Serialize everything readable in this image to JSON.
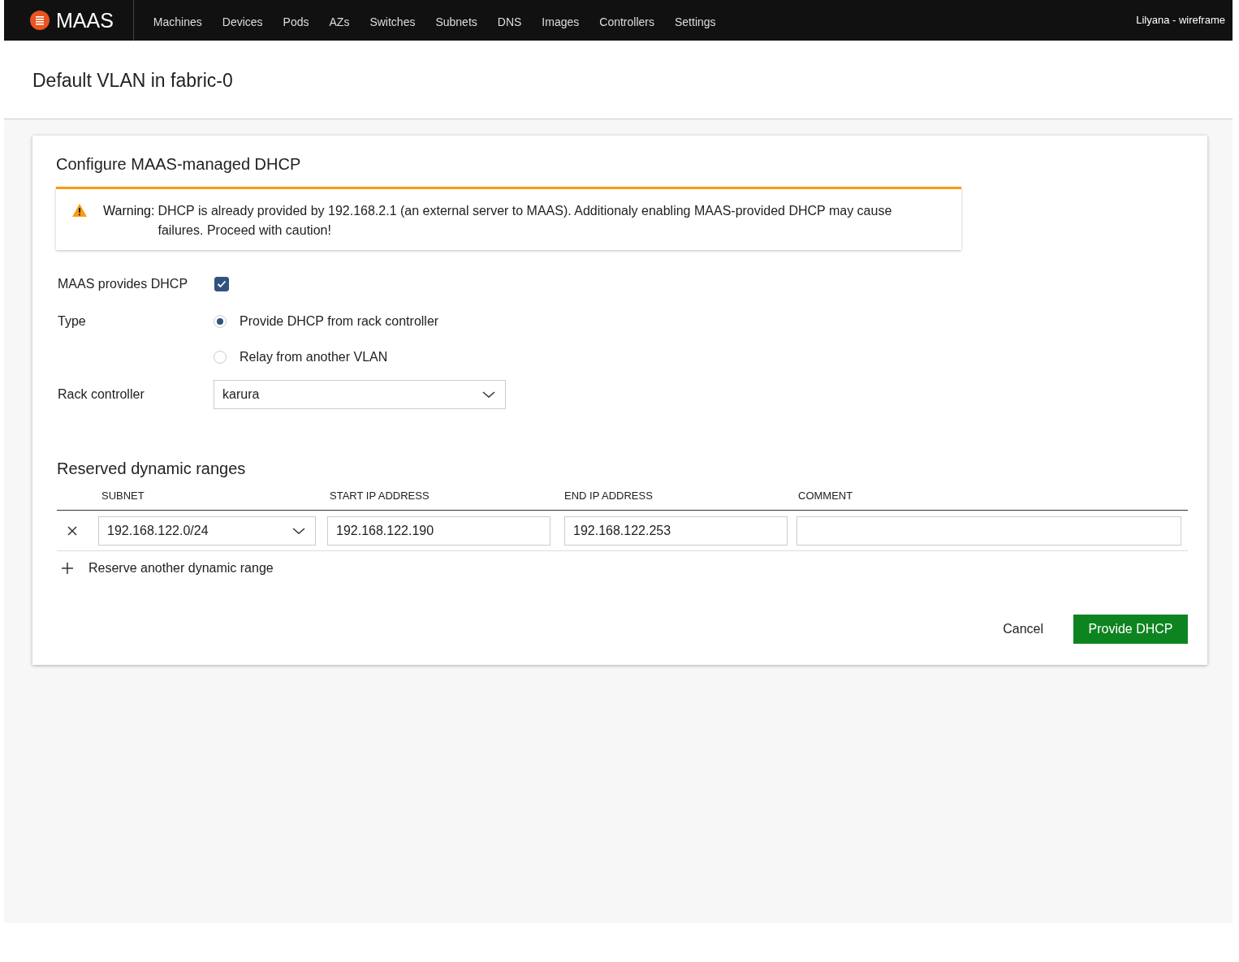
{
  "nav": {
    "logo": "MAAS",
    "items": [
      {
        "label": "Machines",
        "selected": false
      },
      {
        "label": "Devices",
        "selected": false
      },
      {
        "label": "Pods",
        "selected": false
      },
      {
        "label": "AZs",
        "selected": false
      },
      {
        "label": "Switches",
        "selected": false
      },
      {
        "label": "Subnets",
        "selected": false
      },
      {
        "label": "DNS",
        "selected": false
      },
      {
        "label": "Images",
        "selected": false
      },
      {
        "label": "Controllers",
        "selected": false
      },
      {
        "label": "Settings",
        "selected": false
      }
    ],
    "user": "Lilyana - wireframe"
  },
  "page_title": "Default VLAN in fabric-0",
  "card": {
    "title": "Configure MAAS-managed DHCP",
    "warning": {
      "label": "Warning:",
      "message": "DHCP is already provided by 192.168.2.1 (an external server to MAAS). Additionaly enabling MAAS-provided DHCP may cause failures. Proceed with caution!"
    },
    "form": [
      {
        "kind": "checkbox",
        "label": "MAAS provides DHCP",
        "checked": true
      },
      {
        "kind": "radio",
        "label": "Type",
        "options": [
          {
            "label": "Provide DHCP from rack controller",
            "selected": true
          },
          {
            "label": "Relay from another VLAN",
            "selected": false
          }
        ]
      },
      {
        "kind": "select",
        "label": "Rack controller",
        "value": "karura"
      }
    ],
    "ranges": {
      "title": "Reserved dynamic ranges",
      "columns": [
        "SUBNET",
        "START IP ADDRESS",
        "END IP ADDRESS",
        "COMMENT"
      ],
      "rows": [
        {
          "subnet": "192.168.122.0/24",
          "start": "192.168.122.190",
          "end": "192.168.122.253"
        }
      ],
      "add_link": "Reserve another dynamic range"
    },
    "buttons": [
      {
        "kind": "cancel",
        "label": "Cancel"
      },
      {
        "kind": "primary",
        "label": "Provide DHCP"
      }
    ]
  }
}
